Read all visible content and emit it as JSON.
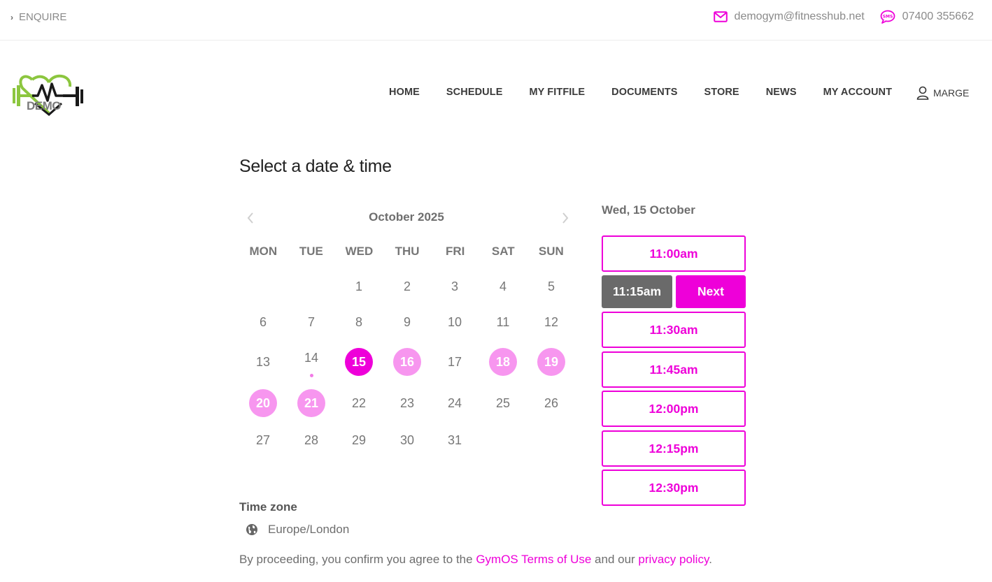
{
  "topbar": {
    "enquire_label": "ENQUIRE",
    "email": "demogym@fitnesshub.net",
    "phone": "07400 355662",
    "email_icon": "envelope-icon",
    "phone_icon": "sms-icon"
  },
  "header": {
    "logo_text": "DEMO",
    "nav": [
      "HOME",
      "SCHEDULE",
      "MY FITFILE",
      "DOCUMENTS",
      "STORE",
      "NEWS",
      "MY ACCOUNT"
    ],
    "account_name": "MARGE"
  },
  "page": {
    "title": "Select a date & time"
  },
  "calendar": {
    "month_label": "October 2025",
    "weekdays": [
      "MON",
      "TUE",
      "WED",
      "THU",
      "FRI",
      "SAT",
      "SUN"
    ],
    "first_weekday_index": 2,
    "days_in_month": 31,
    "today": 14,
    "selected": 15,
    "available": [
      15,
      16,
      18,
      19,
      20,
      21
    ]
  },
  "slots": {
    "date_label": "Wed, 15 October",
    "selected_time": "11:15am",
    "next_label": "Next",
    "before": [
      "11:00am"
    ],
    "after": [
      "11:30am",
      "11:45am",
      "12:00pm",
      "12:15pm",
      "12:30pm"
    ]
  },
  "timezone": {
    "label": "Time zone",
    "value": "Europe/London"
  },
  "terms": {
    "prefix": "By proceeding, you confirm you agree to the ",
    "link1": "GymOS Terms of Use",
    "middle": " and our ",
    "link2": "privacy policy",
    "suffix": "."
  },
  "colors": {
    "accent": "#ee00d9",
    "accent_light": "#f796ef",
    "selected_slot": "#6a6a6a",
    "logo_green": "#8cc63f"
  }
}
